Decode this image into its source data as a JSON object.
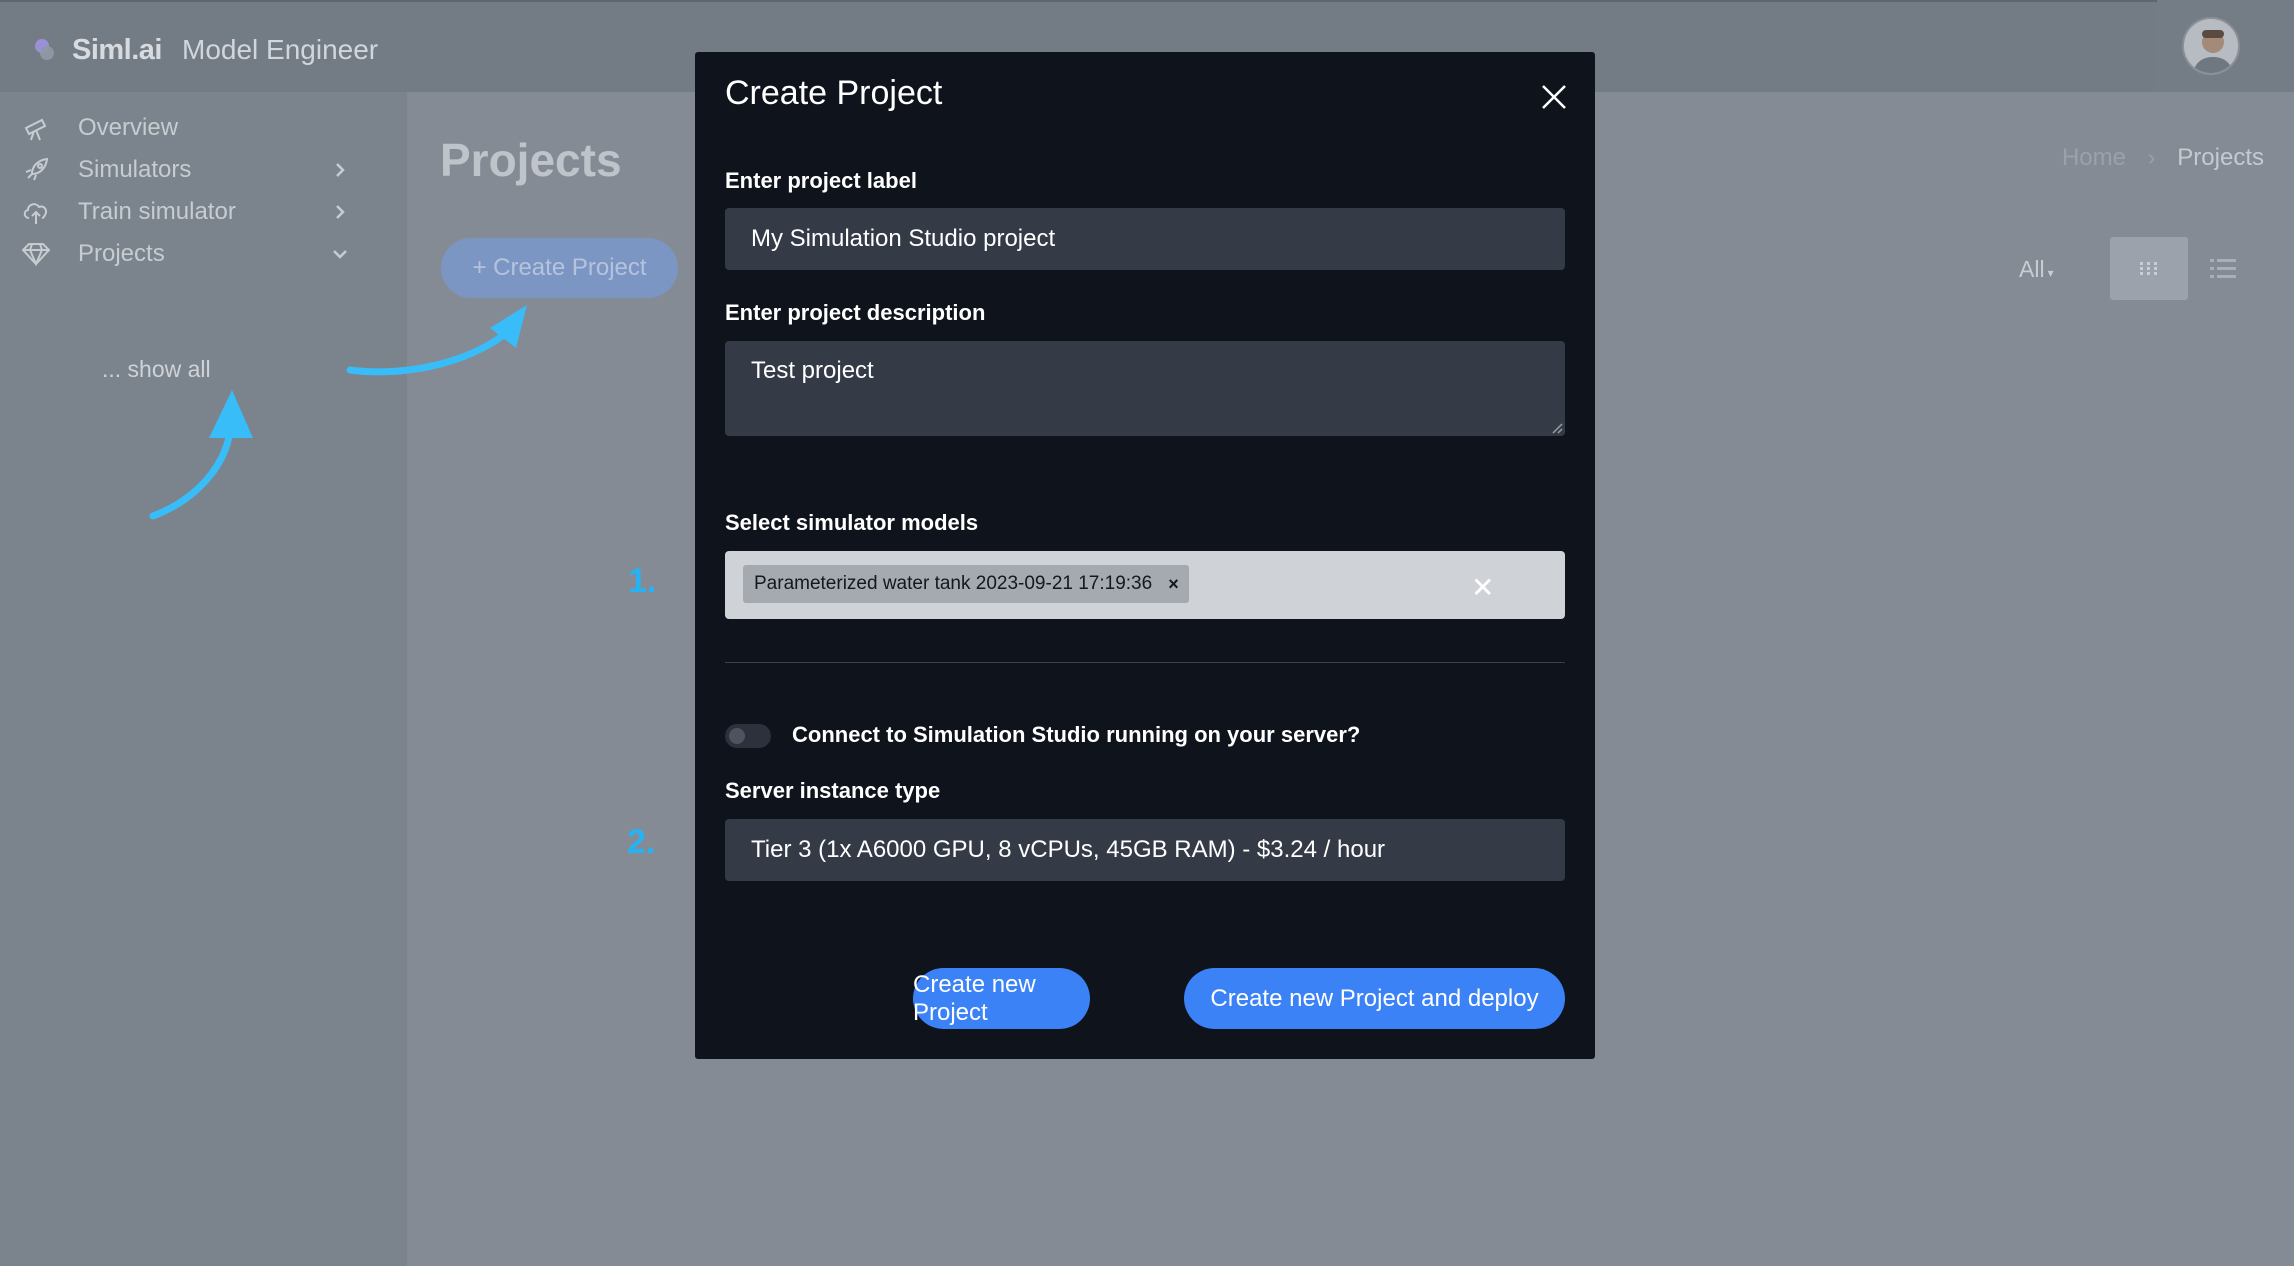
{
  "app": {
    "brand_name": "Siml.ai",
    "product_name": "Model Engineer"
  },
  "sidebar": {
    "items": [
      {
        "label": "Overview",
        "icon": "telescope-icon"
      },
      {
        "label": "Simulators",
        "icon": "rocket-icon"
      },
      {
        "label": "Train simulator",
        "icon": "cloud-upload-icon"
      },
      {
        "label": "Projects",
        "icon": "diamond-icon"
      }
    ],
    "show_all": "... show all"
  },
  "page": {
    "title": "Projects",
    "create_button": "+ Create Project",
    "breadcrumb": {
      "home": "Home",
      "sep": "›",
      "current": "Projects"
    },
    "filter": "All"
  },
  "modal": {
    "title": "Create Project",
    "label_field": {
      "label": "Enter project label",
      "value": "My Simulation Studio project"
    },
    "description_field": {
      "label": "Enter project description",
      "value": "Test project"
    },
    "models_field": {
      "label": "Select simulator models",
      "selected_tag": "Parameterized water tank 2023-09-21 17:19:36",
      "tag_remove": "×",
      "clear": "✕"
    },
    "toggle": {
      "label": "Connect to Simulation Studio running on your server?",
      "on": false
    },
    "server_field": {
      "label": "Server instance type",
      "value": "Tier 3 (1x A6000 GPU, 8 vCPUs, 45GB RAM) - $3.24 / hour"
    },
    "create_button": "Create new Project",
    "create_deploy_button": "Create new Project and deploy"
  },
  "annotations": {
    "step1": "1.",
    "step2": "2.",
    "accent_color": "#38bdf8"
  },
  "colors": {
    "primary": "#3b82f6",
    "modal_bg": "#0f131c",
    "overlay": "#7a828b"
  }
}
